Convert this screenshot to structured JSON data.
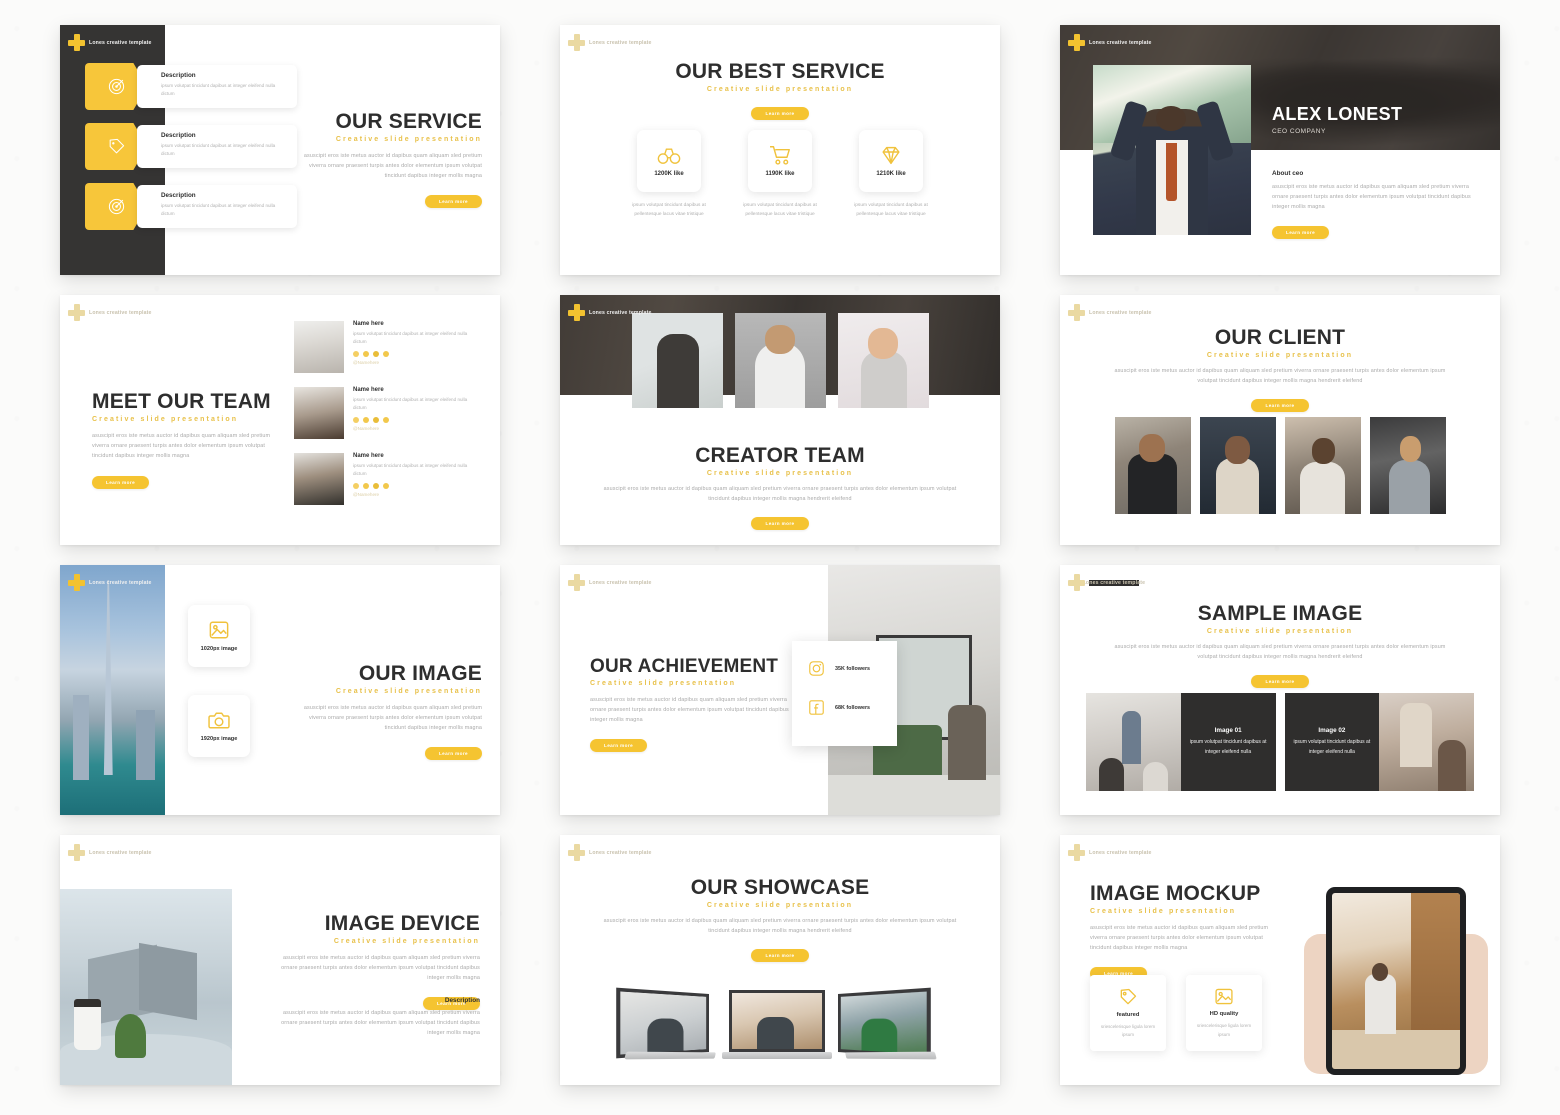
{
  "brand": {
    "logo_text": "Lones creative template",
    "logo_icon": "plus-cross-icon",
    "accent": "#F5C431",
    "dark": "#353433",
    "subtitle_color": "#E8C14A"
  },
  "common": {
    "subtitle": "Creative slide presentation",
    "button_label": "Learn more",
    "paragraph_short": "asuscipit eros iste metus auctor id dapibus quam aliquam sled pretium viverra ornare praesent turpis antes dolor elementum ipsum volutpat tincidunt dapibus integer mollis magna",
    "paragraph_long": "asuscipit eros iste metus auctor id dapibus quam aliquam sled pretium viverra ornare praesent turpis antes dolor elementum ipsum volutpat tincidunt dapibus integer mollis magna hendrerit eleifend"
  },
  "slides": [
    {
      "id": 1,
      "title": "OUR SERVICE",
      "subtitle": "Creative slide presentation",
      "button": "Learn more",
      "paragraph": "asuscipit eros iste metus auctor id dapibus quam aliquam sled pretium viverra ornare praesent turpis antes dolor elementum ipsum volutpat tincidunt dapibus integer mollis magna",
      "features": [
        {
          "icon": "target-icon",
          "title": "Description",
          "text": "ipsum volutpat tincidunt dapibus at integer eleifend nulla dictum"
        },
        {
          "icon": "tag-icon",
          "title": "Description",
          "text": "ipsum volutpat tincidunt dapibus at integer eleifend nulla dictum"
        },
        {
          "icon": "target-icon",
          "title": "Description",
          "text": "ipsum volutpat tincidunt dapibus at integer eleifend nulla dictum"
        }
      ]
    },
    {
      "id": 2,
      "title": "OUR BEST SERVICE",
      "subtitle": "Creative slide presentation",
      "button": "Learn more",
      "cards": [
        {
          "icon": "binoculars-icon",
          "value": "1200K like",
          "caption": "ipsum volutpat tincidunt dapibus at pellentesque lacus vitae tristique"
        },
        {
          "icon": "shopping-cart-icon",
          "value": "1190K like",
          "caption": "ipsum volutpat tincidunt dapibus at pellentesque lacus vitae tristique"
        },
        {
          "icon": "diamond-icon",
          "value": "1210K like",
          "caption": "ipsum volutpat tincidunt dapibus at pellentesque lacus vitae tristique"
        }
      ]
    },
    {
      "id": 3,
      "name": "ALEX LONEST",
      "role": "CEO COMPANY",
      "about_title": "About ceo",
      "about_text": "asuscipit eros iste metus auctor id dapibus quam aliquam sled pretium viverra ornare praesent turpis antes dolor elementum ipsum volutpat tincidunt dapibus integer mollis magna",
      "button": "Learn more"
    },
    {
      "id": 4,
      "title": "MEET OUR TEAM",
      "subtitle": "Creative slide presentation",
      "button": "Learn more",
      "paragraph": "asuscipit eros iste metus auctor id dapibus quam aliquam sled pretium viverra ornare praesent turpis antes dolor elementum ipsum volutpat tincidunt dapibus integer mollis magna",
      "members": [
        {
          "name": "Name here",
          "text": "ipsum volutpat tincidunt dapibus at integer eleifend nulla dictum",
          "handle": "@Namehere",
          "socials": [
            "twitter-icon",
            "instagram-icon",
            "facebook-icon",
            "share-icon"
          ]
        },
        {
          "name": "Name here",
          "text": "ipsum volutpat tincidunt dapibus at integer eleifend nulla dictum",
          "handle": "@Namehere",
          "socials": [
            "twitter-icon",
            "instagram-icon",
            "facebook-icon",
            "share-icon"
          ]
        },
        {
          "name": "Name here",
          "text": "ipsum volutpat tincidunt dapibus at integer eleifend nulla dictum",
          "handle": "@Namehere",
          "socials": [
            "twitter-icon",
            "instagram-icon",
            "facebook-icon",
            "share-icon"
          ]
        }
      ]
    },
    {
      "id": 5,
      "title": "CREATOR TEAM",
      "subtitle": "Creative slide presentation",
      "button": "Learn more",
      "paragraph": "asuscipit eros iste metus auctor id dapibus quam aliquam sled pretium viverra ornare praesent turpis antes dolor elementum ipsum volutpat tincidunt dapibus integer mollis magna hendrerit eleifend"
    },
    {
      "id": 6,
      "title": "OUR CLIENT",
      "subtitle": "Creative slide presentation",
      "button": "Learn more",
      "paragraph": "asuscipit eros iste metus auctor id dapibus quam aliquam sled pretium viverra ornare praesent turpis antes dolor elementum ipsum volutpat tincidunt dapibus integer mollis magna hendrerit eleifend"
    },
    {
      "id": 7,
      "title": "OUR IMAGE",
      "subtitle": "Creative slide presentation",
      "button": "Learn more",
      "paragraph": "asuscipit eros iste metus auctor id dapibus quam aliquam sled pretium viverra ornare praesent turpis antes dolor elementum ipsum volutpat tincidunt dapibus integer mollis magna",
      "cards": [
        {
          "icon": "image-icon",
          "label": "1020px image"
        },
        {
          "icon": "camera-icon",
          "label": "1920px image"
        }
      ]
    },
    {
      "id": 8,
      "title": "OUR ACHIEVEMENT",
      "subtitle": "Creative slide presentation",
      "button": "Learn more",
      "paragraph": "asuscipit eros iste metus auctor id dapibus quam aliquam sled pretium viverra ornare praesent turpis antes dolor elementum ipsum volutpat tincidunt dapibus integer mollis magna",
      "stats": [
        {
          "icon": "instagram-icon",
          "value": "35K followers"
        },
        {
          "icon": "facebook-icon",
          "value": "68K followers"
        }
      ]
    },
    {
      "id": 9,
      "title": "SAMPLE IMAGE",
      "subtitle": "Creative slide presentation",
      "button": "Learn more",
      "paragraph": "asuscipit eros iste metus auctor id dapibus quam aliquam sled pretium viverra ornare praesent turpis antes dolor elementum ipsum volutpat tincidunt dapibus integer mollis magna hendrerit eleifend",
      "blocks": [
        {
          "title": "Image 01",
          "text": "ipsum volutpat tincidunt dapibus at integer eleifend nulla"
        },
        {
          "title": "Image 02",
          "text": "ipsum volutpat tincidunt dapibus at integer eleifend nulla"
        }
      ]
    },
    {
      "id": 10,
      "title": "IMAGE DEVICE",
      "subtitle": "Creative slide presentation",
      "button": "Learn more",
      "paragraph": "asuscipit eros iste metus auctor id dapibus quam aliquam sled pretium viverra ornare praesent turpis antes dolor elementum ipsum volutpat tincidunt dapibus integer mollis magna",
      "desc_title": "Description",
      "desc_text": "asuscipit eros iste metus auctor id dapibus quam aliquam sled pretium viverra ornare praesent turpis antes dolor elementum ipsum volutpat tincidunt dapibus integer mollis magna"
    },
    {
      "id": 11,
      "title": "OUR SHOWCASE",
      "subtitle": "Creative slide presentation",
      "button": "Learn more",
      "paragraph": "asuscipit eros iste metus auctor id dapibus quam aliquam sled pretium viverra ornare praesent turpis antes dolor elementum ipsum volutpat tincidunt dapibus integer mollis magna hendrerit eleifend"
    },
    {
      "id": 12,
      "title": "IMAGE MOCKUP",
      "subtitle": "Creative slide presentation",
      "button": "Learn more",
      "paragraph": "asuscipit eros iste metus auctor id dapibus quam aliquam sled pretium viverra ornare praesent turpis antes dolor elementum ipsum volutpat tincidunt dapibus integer mollis magna",
      "cards": [
        {
          "icon": "tag-icon",
          "title": "featured",
          "text": "sriescelerisque ligula lorem ipsum"
        },
        {
          "icon": "image-icon",
          "title": "HD quality",
          "text": "sriescelerisque ligula lorem ipsum"
        }
      ]
    }
  ]
}
